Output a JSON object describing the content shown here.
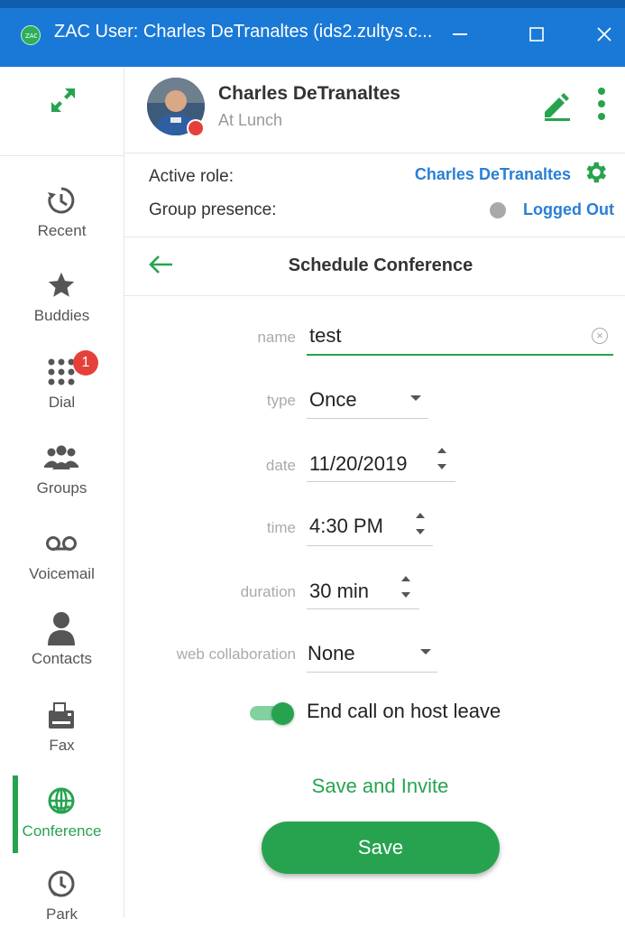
{
  "window": {
    "title": "ZAC User: Charles DeTranaltes (ids2.zultys.c..."
  },
  "nav": {
    "items": [
      {
        "label": "Recent",
        "icon": "history-icon"
      },
      {
        "label": "Buddies",
        "icon": "star-icon"
      },
      {
        "label": "Dial",
        "icon": "dialpad-icon",
        "badge": "1"
      },
      {
        "label": "Groups",
        "icon": "groups-icon"
      },
      {
        "label": "Voicemail",
        "icon": "voicemail-icon"
      },
      {
        "label": "Contacts",
        "icon": "person-icon"
      },
      {
        "label": "Fax",
        "icon": "fax-icon"
      },
      {
        "label": "Conference",
        "icon": "globe-phone-icon",
        "active": true
      },
      {
        "label": "Park",
        "icon": "park-icon"
      }
    ]
  },
  "profile": {
    "name": "Charles DeTranaltes",
    "status": "At Lunch"
  },
  "role": {
    "active_label": "Active role:",
    "active_value": "Charles DeTranaltes",
    "group_label": "Group presence:",
    "group_value": "Logged Out"
  },
  "page": {
    "title": "Schedule Conference"
  },
  "form": {
    "name_label": "name",
    "name_value": "test",
    "type_label": "type",
    "type_value": "Once",
    "date_label": "date",
    "date_value": "11/20/2019",
    "time_label": "time",
    "time_value": "4:30 PM",
    "duration_label": "duration",
    "duration_value": "30 min",
    "webcollab_label": "web collaboration",
    "webcollab_value": "None",
    "end_call_label": "End call on host leave",
    "end_call_on": true
  },
  "actions": {
    "save_invite": "Save and Invite",
    "save": "Save"
  },
  "colors": {
    "titlebar": "#1a79d6",
    "accent": "#27a350",
    "link": "#2a7fd4",
    "badge": "#e5413a"
  }
}
